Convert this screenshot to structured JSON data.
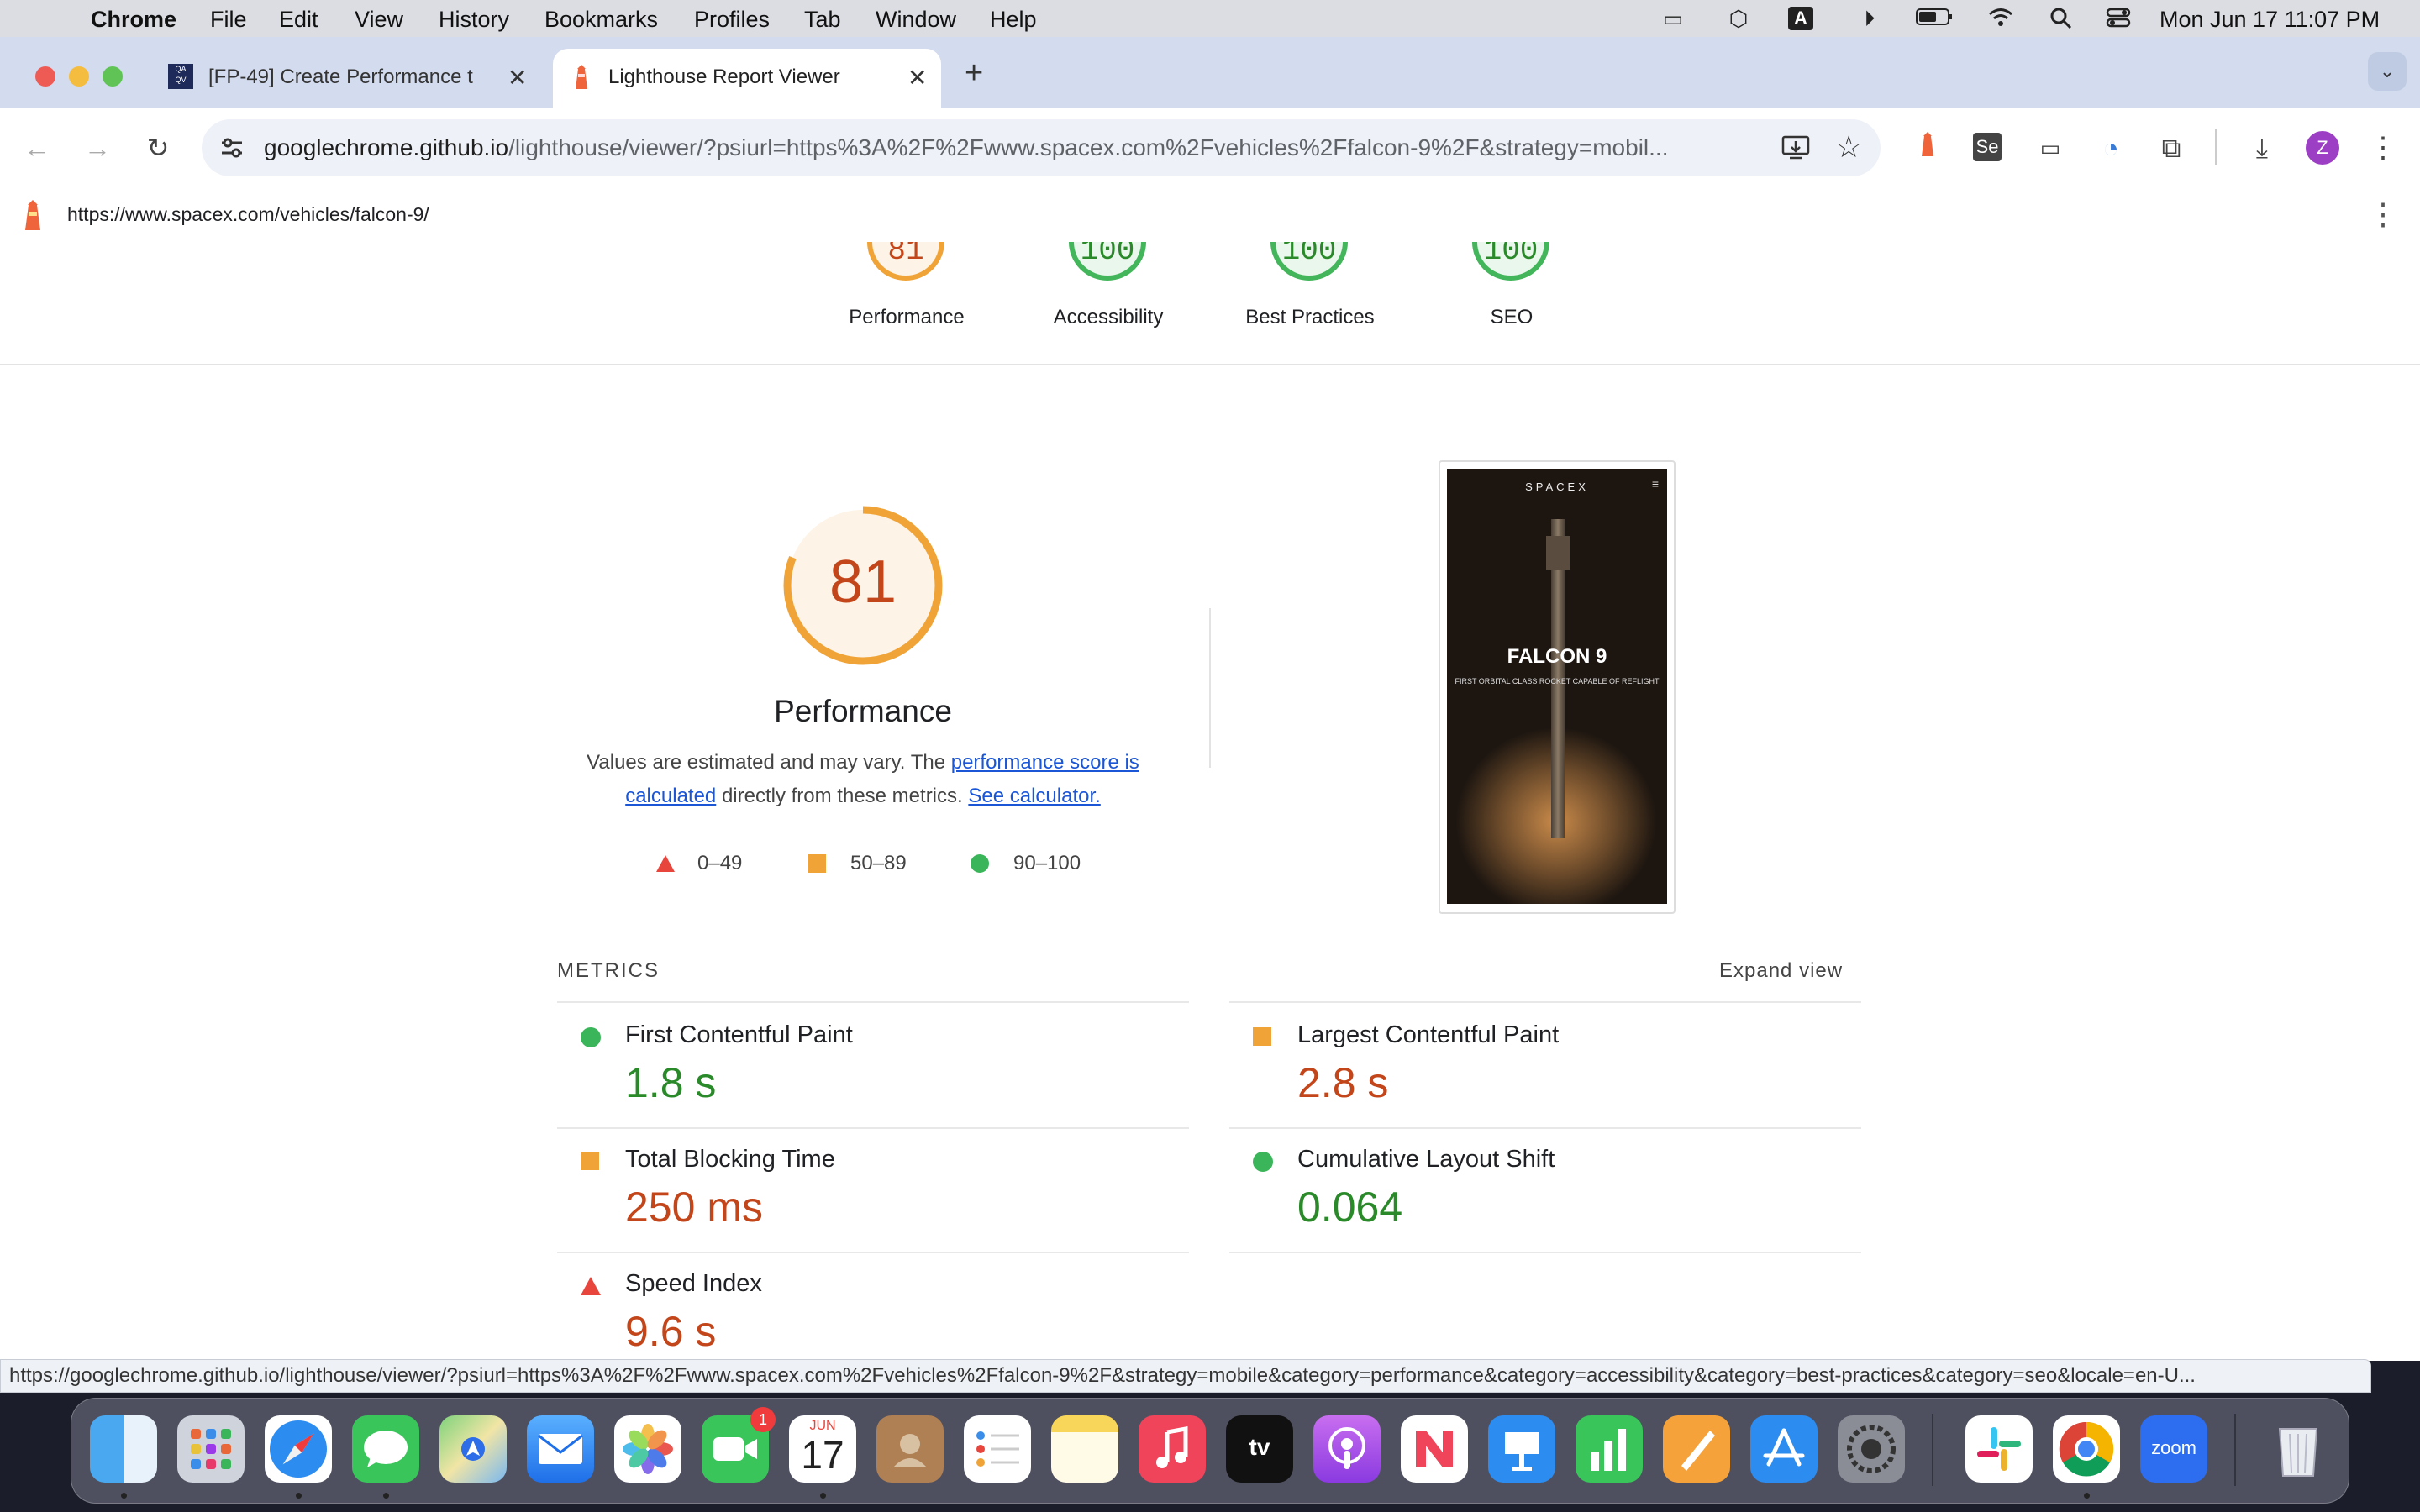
{
  "menubar": {
    "app": "Chrome",
    "items": [
      "File",
      "Edit",
      "View",
      "History",
      "Bookmarks",
      "Profiles",
      "Tab",
      "Window",
      "Help"
    ],
    "input_source": "A",
    "clock": "Mon Jun 17  11:07 PM"
  },
  "tabs": [
    {
      "title": "[FP-49] Create Performance t",
      "favicon": "qa-logo-icon"
    },
    {
      "title": "Lighthouse Report Viewer",
      "favicon": "lighthouse-icon"
    }
  ],
  "toolbar": {
    "url_host": "googlechrome.github.io",
    "url_path": "/lighthouse/viewer/?psiurl=https%3A%2F%2Fwww.spacex.com%2Fvehicles%2Ffalcon-9%2F&strategy=mobil...",
    "profile_initial": "Z"
  },
  "lighthouse_bar": {
    "url": "https://www.spacex.com/vehicles/falcon-9/"
  },
  "summary_gauges": [
    {
      "score": "81",
      "label": "Performance",
      "color": "#e8a33c"
    },
    {
      "score": "100",
      "label": "Accessibility",
      "color": "#43b55a"
    },
    {
      "score": "100",
      "label": "Best Practices",
      "color": "#43b55a"
    },
    {
      "score": "100",
      "label": "SEO",
      "color": "#43b55a"
    }
  ],
  "performance": {
    "score": "81",
    "score_fraction": 0.81,
    "title": "Performance",
    "desc_prefix": "Values are estimated and may vary. The ",
    "desc_link1_a": "performance score is",
    "desc_link1_b": "calculated",
    "desc_middle": " directly from these metrics. ",
    "desc_link2": "See calculator.",
    "legend": [
      {
        "shape": "triangle",
        "range": "0–49",
        "color": "#e8453c"
      },
      {
        "shape": "square",
        "range": "50–89",
        "color": "#f0a438"
      },
      {
        "shape": "circle",
        "range": "90–100",
        "color": "#3bb55a"
      }
    ]
  },
  "screenshot": {
    "brand": "SPACEX",
    "headline": "FALCON 9",
    "subline": "FIRST ORBITAL CLASS ROCKET CAPABLE OF REFLIGHT"
  },
  "metrics": {
    "header": "METRICS",
    "expand": "Expand view",
    "items": [
      {
        "name": "First Contentful Paint",
        "value": "1.8 s",
        "status": "pass",
        "color": "#2a8a2a"
      },
      {
        "name": "Largest Contentful Paint",
        "value": "2.8 s",
        "status": "average",
        "color": "#c3461b"
      },
      {
        "name": "Total Blocking Time",
        "value": "250 ms",
        "status": "average",
        "color": "#c3461b"
      },
      {
        "name": "Cumulative Layout Shift",
        "value": "0.064",
        "status": "pass",
        "color": "#2a8a2a"
      },
      {
        "name": "Speed Index",
        "value": "9.6 s",
        "status": "fail",
        "color": "#c3461b"
      }
    ]
  },
  "status_url": "https://googlechrome.github.io/lighthouse/viewer/?psiurl=https%3A%2F%2Fwww.spacex.com%2Fvehicles%2Ffalcon-9%2F&strategy=mobile&category=performance&category=accessibility&category=best-practices&category=seo&locale=en-U...",
  "dock": {
    "calendar_month": "JUN",
    "calendar_day": "17",
    "facetime_badge": "1",
    "tv_label": "tv",
    "zoom_label": "zoom"
  }
}
